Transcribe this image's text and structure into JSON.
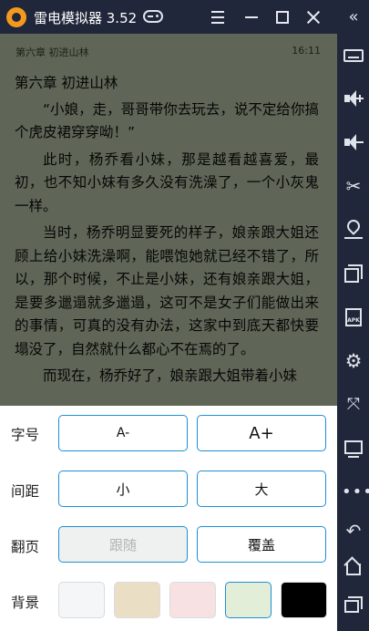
{
  "titlebar": {
    "app_title": "雷电模拟器 3.52"
  },
  "reader": {
    "header_chapter": "第六章 初进山林",
    "header_time": "16:11",
    "chapter_title": "第六章 初进山林",
    "paragraphs": [
      "“小娘，走，哥哥带你去玩去，说不定给你搞个虎皮裙穿穿呦！”",
      "此时，杨乔看小妹，那是越看越喜爱，最初，也不知小妹有多久没有洗澡了，一个小灰鬼一样。",
      "当时，杨乔明显要死的样子，娘亲跟大姐还顾上给小妹洗澡啊，能喂饱她就已经不错了，所以，那个时候，不止是小妹，还有娘亲跟大姐，是要多邋遢就多邋遢，这可不是女子们能做出来的事情，可真的没有办法，这家中到底天都快要塌没了，自然就什么都心不在焉的了。",
      "而现在，杨乔好了，娘亲跟大姐带着小妹"
    ]
  },
  "settings": {
    "font_size": {
      "label": "字号",
      "decrease": "A-",
      "increase": "A+"
    },
    "spacing": {
      "label": "间距",
      "small": "小",
      "large": "大"
    },
    "page_turn": {
      "label": "翻页",
      "follow": "跟随",
      "cover": "覆盖"
    },
    "background": {
      "label": "背景",
      "swatches": [
        "#f5f6f8",
        "#eadfc4",
        "#f7e1e2",
        "#e3eed9",
        "#000000"
      ],
      "selected_index": 3
    }
  },
  "colors": {
    "accent": "#1e8fd6",
    "chrome": "#21273a",
    "reader_dim_bg": "#5f6657",
    "logo": "#f39a1e"
  }
}
